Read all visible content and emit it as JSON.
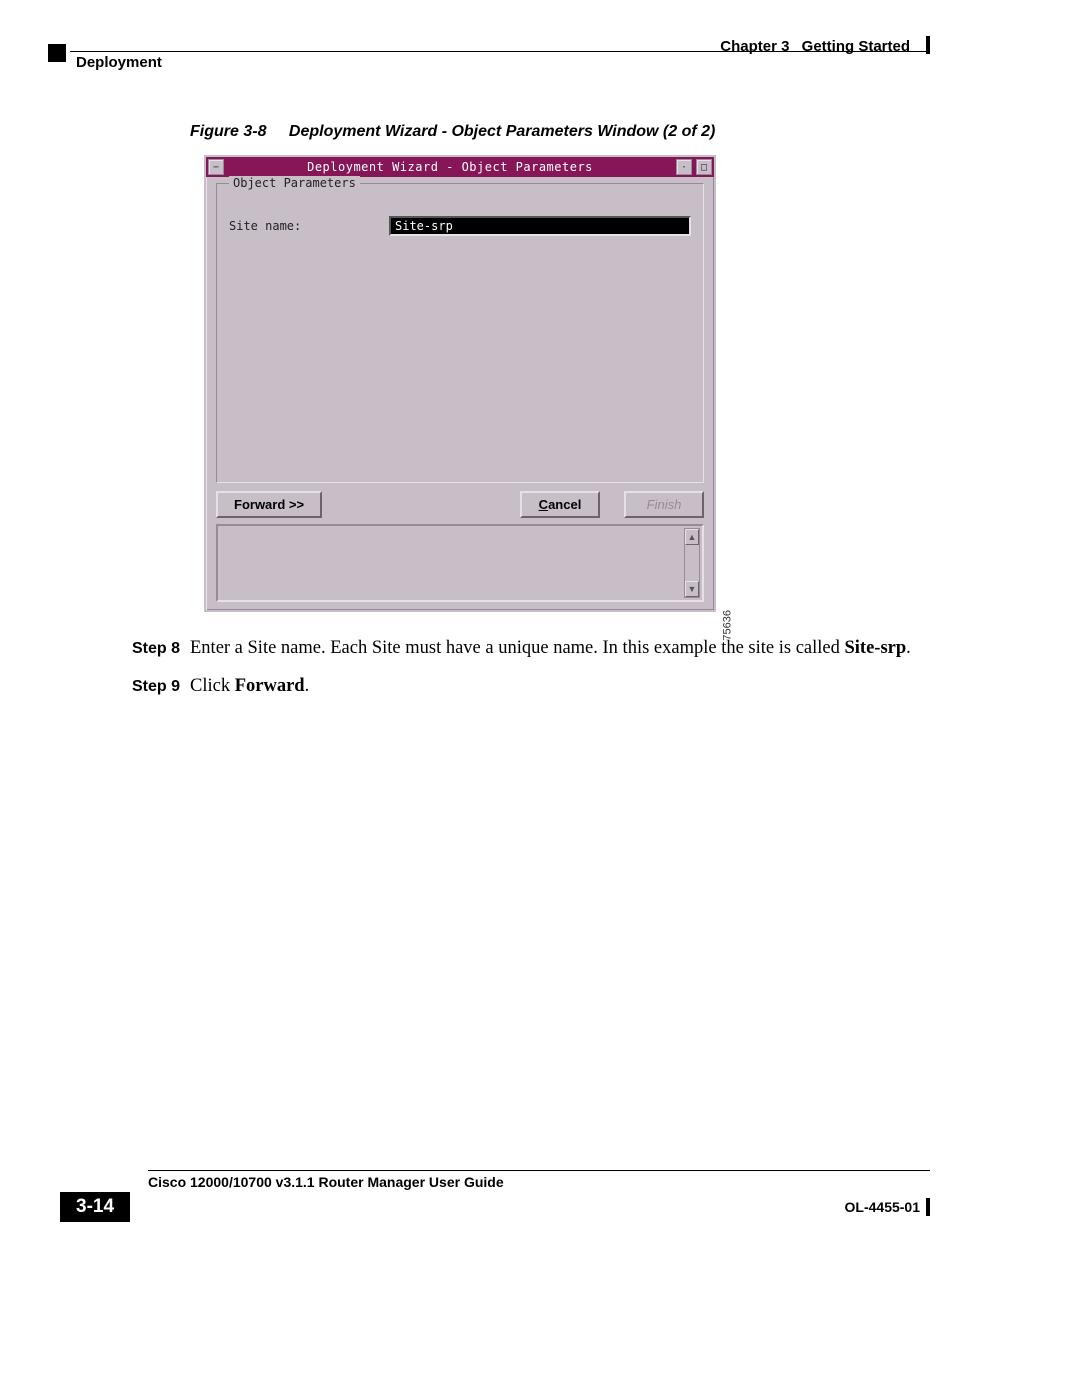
{
  "header": {
    "chapter_label": "Chapter 3",
    "chapter_title": "Getting Started",
    "section": "Deployment"
  },
  "figure": {
    "number": "Figure 3-8",
    "title": "Deployment Wizard - Object Parameters Window (2 of 2)",
    "image_id": "75636"
  },
  "dialog": {
    "title": "Deployment Wizard - Object Parameters",
    "fieldset_legend": "Object Parameters",
    "site_name_label": "Site name:",
    "site_name_value": "Site-srp",
    "buttons": {
      "forward": "Forward >>",
      "cancel": "Cancel",
      "finish": "Finish"
    }
  },
  "steps": [
    {
      "label": "Step 8",
      "text_pre": "Enter a Site name. Each Site must have a unique name. In this example the site is called ",
      "bold": "Site-srp",
      "text_post": "."
    },
    {
      "label": "Step 9",
      "text_pre": "Click ",
      "bold": "Forward",
      "text_post": "."
    }
  ],
  "footer": {
    "guide_title": "Cisco 12000/10700 v3.1.1 Router Manager User Guide",
    "page_number": "3-14",
    "doc_id": "OL-4455-01"
  }
}
